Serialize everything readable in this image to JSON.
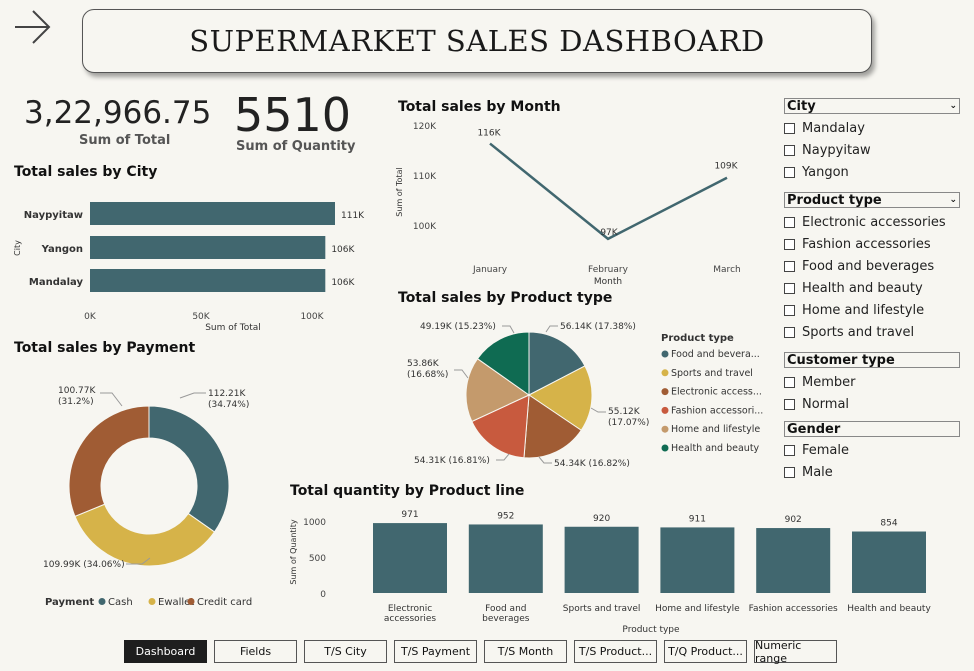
{
  "header": {
    "title": "SUPERMARKET SALES DASHBOARD"
  },
  "kpis": {
    "total_value": "3,22,966.75",
    "total_label": "Sum of Total",
    "quantity_value": "5510",
    "quantity_label": "Sum of Quantity"
  },
  "city_chart": {
    "title": "Total sales by City",
    "xlabel": "Sum of Total",
    "ylabel": "City",
    "categories": [
      "Naypyitaw",
      "Yangon",
      "Mandalay"
    ],
    "values": [
      110568.71,
      106200.37,
      106197.67
    ],
    "labels": [
      "111K",
      "106K",
      "106K"
    ],
    "ticks": [
      "0K",
      "50K",
      "100K"
    ],
    "xlim": [
      0,
      110568.71
    ]
  },
  "month_chart": {
    "title": "Total sales by Month",
    "xlabel": "Month",
    "ylabel": "Sum of Total",
    "categories": [
      "January",
      "February",
      "March"
    ],
    "values": [
      116290,
      97219,
      109456
    ],
    "labels": [
      "116K",
      "97K",
      "109K"
    ],
    "yticks": [
      "120K",
      "110K",
      "100K"
    ],
    "ylim": [
      95000,
      120000
    ]
  },
  "payment_chart": {
    "title": "Total sales by Payment",
    "legend_title": "Payment",
    "slices": [
      {
        "name": "Cash",
        "value": 112206.57,
        "label": "112.21K\n(34.74%)",
        "color": "#41676f"
      },
      {
        "name": "Ewallet",
        "value": 109993.11,
        "label": "109.99K (34.06%)",
        "color": "#d6b349"
      },
      {
        "name": "Credit card",
        "value": 100767.07,
        "label": "100.77K\n(31.2%)",
        "color": "#a05c34"
      }
    ]
  },
  "product_pie": {
    "title": "Total sales by Product type",
    "legend_title": "Product type",
    "slices": [
      {
        "name": "Food and bevera...",
        "value": 56140,
        "label": "56.14K (17.38%)",
        "color": "#41676f"
      },
      {
        "name": "Sports and travel",
        "value": 55120,
        "label": "55.12K\n(17.07%)",
        "color": "#d6b349"
      },
      {
        "name": "Electronic access...",
        "value": 54340,
        "label": "54.34K (16.82%)",
        "color": "#a05c34"
      },
      {
        "name": "Fashion accessori...",
        "value": 54310,
        "label": "54.31K (16.81%)",
        "color": "#c85a3e"
      },
      {
        "name": "Home and lifestyle",
        "value": 53860,
        "label": "53.86K\n(16.68%)",
        "color": "#c49a6c"
      },
      {
        "name": "Health and beauty",
        "value": 49190,
        "label": "49.19K (15.23%)",
        "color": "#0f6b52"
      }
    ]
  },
  "quantity_chart": {
    "title": "Total quantity by Product line",
    "xlabel": "Product type",
    "ylabel": "Sum of Quantity",
    "categories": [
      "Electronic\naccessories",
      "Food and\nbeverages",
      "Sports and travel",
      "Home and lifestyle",
      "Fashion accessories",
      "Health and beauty"
    ],
    "values": [
      971,
      952,
      920,
      911,
      902,
      854
    ],
    "yticks": [
      "1000",
      "500",
      "0"
    ],
    "ylim": [
      0,
      1000
    ]
  },
  "slicers": {
    "city": {
      "title": "City",
      "items": [
        "Mandalay",
        "Naypyitaw",
        "Yangon"
      ]
    },
    "product_type": {
      "title": "Product type",
      "items": [
        "Electronic accessories",
        "Fashion accessories",
        "Food and beverages",
        "Health and beauty",
        "Home and lifestyle",
        "Sports and travel"
      ]
    },
    "customer_type": {
      "title": "Customer type",
      "items": [
        "Member",
        "Normal"
      ]
    },
    "gender": {
      "title": "Gender",
      "items": [
        "Female",
        "Male"
      ]
    }
  },
  "tabs": [
    "Dashboard",
    "Fields",
    "T/S City",
    "T/S Payment",
    "T/S Month",
    "T/S Product...",
    "T/Q Product...",
    "Numeric range"
  ],
  "colors": {
    "teal": "#41676f",
    "gold": "#d6b349",
    "brown": "#a05c34",
    "line": "#41676f"
  }
}
